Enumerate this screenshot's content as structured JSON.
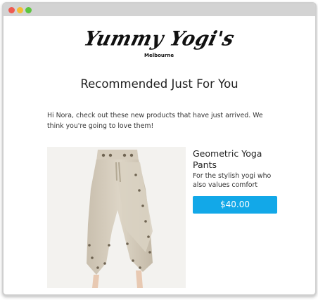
{
  "window": {
    "controls": [
      "close",
      "minimize",
      "maximize"
    ]
  },
  "brand": {
    "logo_text": "Yummy Yogi's",
    "location": "Melbourne"
  },
  "email": {
    "heading": "Recommended Just For You",
    "intro": "Hi Nora, check out these new products that have just arrived. We think you're going to love them!"
  },
  "product": {
    "image_icon": "yoga-pants-photo",
    "title": "Geometric Yoga Pants",
    "description": "For the stylish yogi who also values comfort",
    "price": "$40.00"
  },
  "colors": {
    "button": "#12a8e8",
    "close": "#ee5a51",
    "minimize": "#f3bd33",
    "maximize": "#5bc63f",
    "titlebar": "#d3d3d3"
  }
}
